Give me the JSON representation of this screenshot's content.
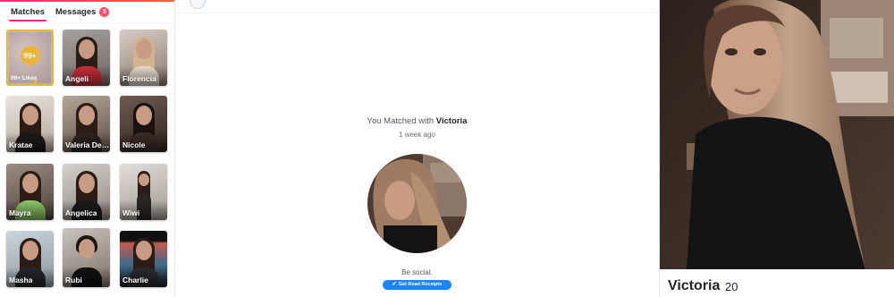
{
  "sidebar": {
    "tabs": [
      {
        "label": "Matches"
      },
      {
        "label": "Messages",
        "badge": "5"
      }
    ],
    "likes_card": {
      "count": "99+",
      "label": "99+ Likes"
    },
    "matches": [
      {
        "name": "Angeli"
      },
      {
        "name": "Florencia"
      },
      {
        "name": "Kratae"
      },
      {
        "name": "Valeria De ..."
      },
      {
        "name": "Nicole"
      },
      {
        "name": "Mayra"
      },
      {
        "name": "Angelica"
      },
      {
        "name": "Wiwi"
      },
      {
        "name": "Masha"
      },
      {
        "name": "Rubi"
      },
      {
        "name": "Charlie"
      }
    ]
  },
  "conversation": {
    "matched_prefix": "You Matched with",
    "matched_name": "Victoria",
    "time_ago": "1 week ago",
    "be_social": "Be social.",
    "read_receipts_button": "Get Read Receipts"
  },
  "profile": {
    "name": "Victoria",
    "age": "20"
  },
  "colors": {
    "brand_pink": "#fd267a",
    "badge_red": "#fd5068",
    "gold": "#e9b43c",
    "blue": "#1786ff"
  },
  "icons": [
    "heart-icon",
    "check-icon"
  ]
}
